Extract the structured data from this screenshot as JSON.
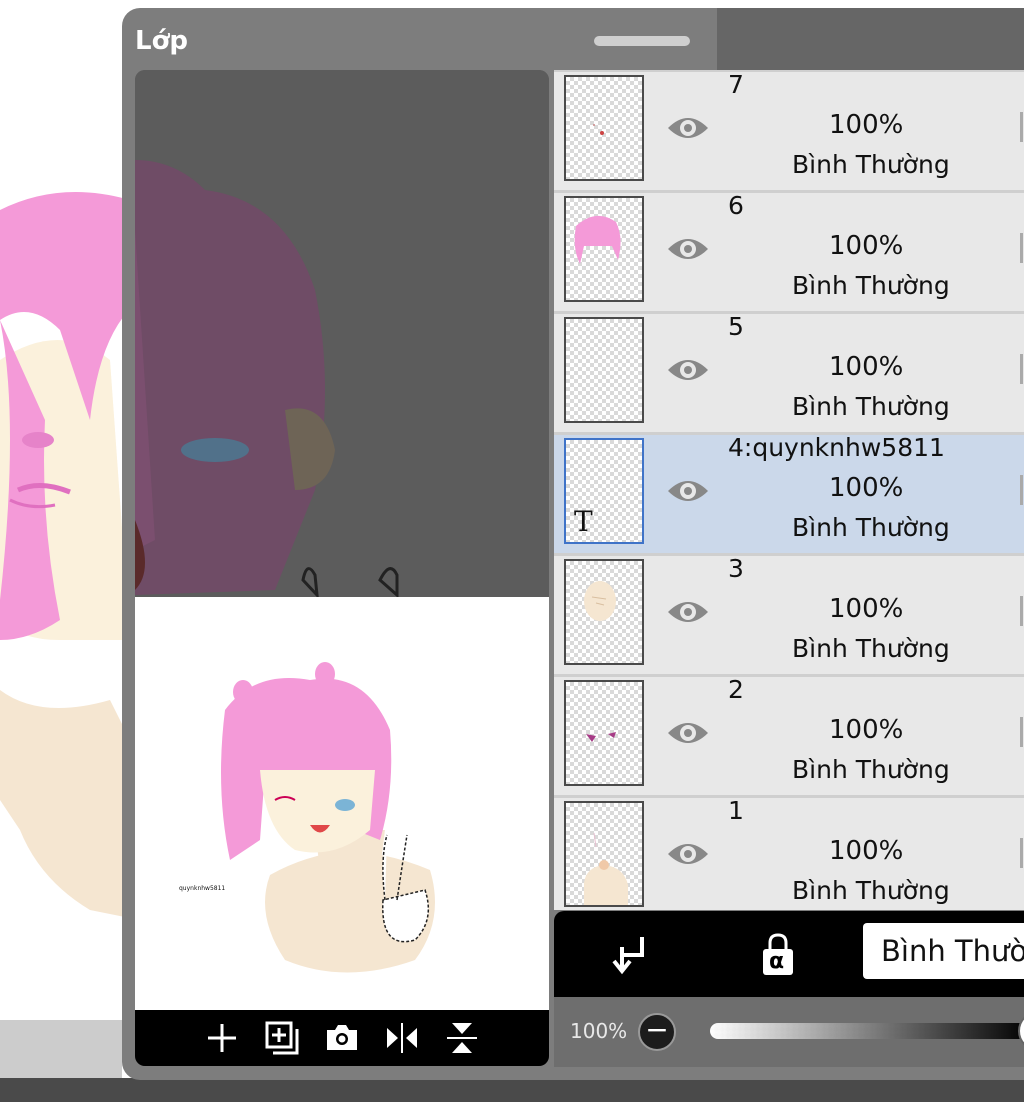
{
  "panel": {
    "title": "Lớp"
  },
  "preview": {
    "signature_text": "quynknhw5811",
    "toolbar": [
      {
        "icon": "plus-icon"
      },
      {
        "icon": "add-layer-icon"
      },
      {
        "icon": "camera-icon"
      },
      {
        "icon": "flip-horizontal-icon"
      },
      {
        "icon": "flip-vertical-icon"
      }
    ]
  },
  "layers": [
    {
      "name": "7",
      "opacity": "100%",
      "mode": "Bình Thường",
      "selected": false,
      "thumb": "dot"
    },
    {
      "name": "6",
      "opacity": "100%",
      "mode": "Bình Thường",
      "selected": false,
      "thumb": "hair"
    },
    {
      "name": "5",
      "opacity": "100%",
      "mode": "Bình Thường",
      "selected": false,
      "thumb": "empty"
    },
    {
      "name": "4:quynknhw5811",
      "opacity": "100%",
      "mode": "Bình Thường",
      "selected": true,
      "thumb": "text"
    },
    {
      "name": "3",
      "opacity": "100%",
      "mode": "Bình Thường",
      "selected": false,
      "thumb": "face"
    },
    {
      "name": "2",
      "opacity": "100%",
      "mode": "Bình Thường",
      "selected": false,
      "thumb": "eyes"
    },
    {
      "name": "1",
      "opacity": "100%",
      "mode": "Bình Thường",
      "selected": false,
      "thumb": "body"
    }
  ],
  "text_thumb_glyph": "T",
  "layer_actions": {
    "clip_icon": "clip-arrow-icon",
    "alpha_lock_icon": "alpha-lock-icon",
    "alpha_lock_glyph": "α",
    "blend_mode": "Bình Thường"
  },
  "opacity": {
    "label": "100%",
    "value": 1.0,
    "minus_glyph": "−"
  },
  "colors": {
    "hair": "#f49ad8",
    "skin": "#f5e6d1",
    "panel": "#7d7d7d",
    "selected_row": "#cbd8ea",
    "selected_border": "#3f73c8"
  }
}
